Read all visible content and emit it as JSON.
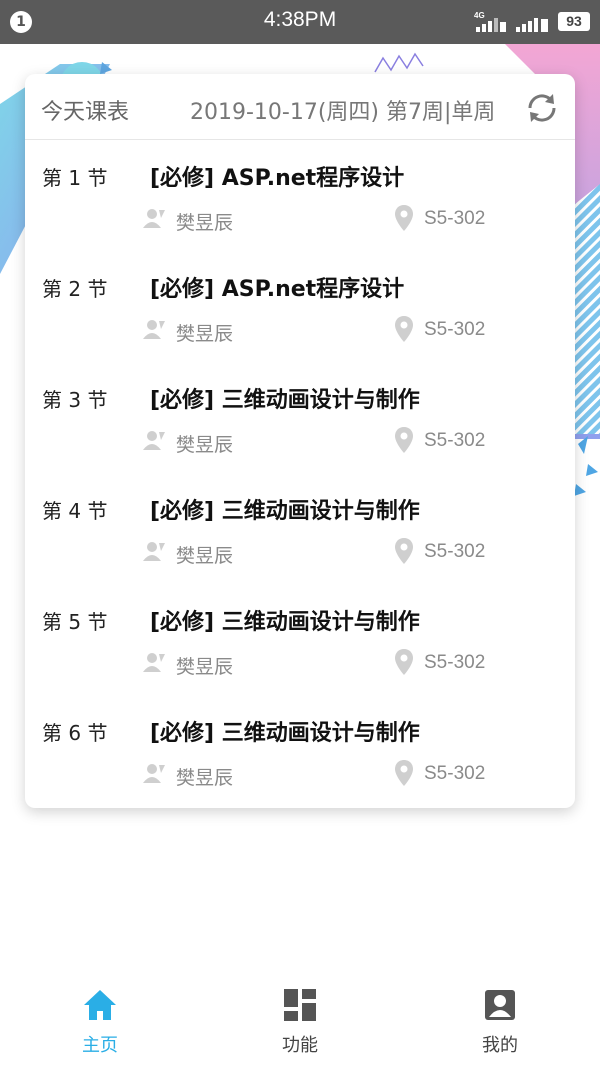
{
  "status_bar": {
    "notification_count": "1",
    "time": "4:38PM",
    "network": "4G",
    "battery": "93"
  },
  "schedule": {
    "title": "今天课表",
    "date_info": "2019-10-17(周四) 第7周|单周",
    "refresh_icon": "refresh-icon",
    "lessons": [
      {
        "period": "第 1 节",
        "course": "[必修] ASP.net程序设计",
        "teacher": "樊昱辰",
        "room": "S5-302"
      },
      {
        "period": "第 2 节",
        "course": "[必修] ASP.net程序设计",
        "teacher": "樊昱辰",
        "room": "S5-302"
      },
      {
        "period": "第 3 节",
        "course": "[必修] 三维动画设计与制作",
        "teacher": "樊昱辰",
        "room": "S5-302"
      },
      {
        "period": "第 4 节",
        "course": "[必修] 三维动画设计与制作",
        "teacher": "樊昱辰",
        "room": "S5-302"
      },
      {
        "period": "第 5 节",
        "course": "[必修] 三维动画设计与制作",
        "teacher": "樊昱辰",
        "room": "S5-302"
      },
      {
        "period": "第 6 节",
        "course": "[必修] 三维动画设计与制作",
        "teacher": "樊昱辰",
        "room": "S5-302"
      }
    ]
  },
  "bottom_nav": {
    "items": [
      {
        "label": "主页",
        "icon": "home-icon",
        "active": true
      },
      {
        "label": "功能",
        "icon": "grid-icon",
        "active": false
      },
      {
        "label": "我的",
        "icon": "profile-icon",
        "active": false
      }
    ]
  },
  "colors": {
    "accent": "#2aaee6",
    "status_bar_bg": "#5a5a5a",
    "muted_text": "#8a8a8a",
    "nav_icon": "#555555"
  }
}
